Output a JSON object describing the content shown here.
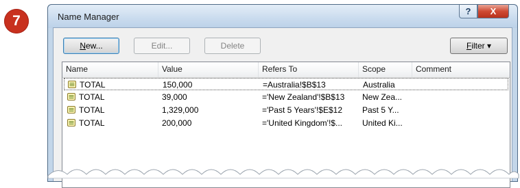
{
  "step": {
    "number": "7"
  },
  "window": {
    "title": "Name Manager",
    "help_label": "?",
    "close_label": "X"
  },
  "toolbar": {
    "new_label_u": "N",
    "new_label_rest": "ew...",
    "edit_label": "Edit...",
    "delete_label": "Delete",
    "filter_label_u": "F",
    "filter_label_rest": "ilter ▾"
  },
  "list": {
    "columns": [
      "Name",
      "Value",
      "Refers To",
      "Scope",
      "Comment"
    ],
    "rows": [
      {
        "name": "TOTAL",
        "value": "150,000",
        "refers_to": "=Australia!$B$13",
        "scope": "Australia",
        "comment": ""
      },
      {
        "name": "TOTAL",
        "value": "39,000",
        "refers_to": "='New Zealand'!$B$13",
        "scope": "New Zea...",
        "comment": ""
      },
      {
        "name": "TOTAL",
        "value": "1,329,000",
        "refers_to": "='Past 5 Years'!$E$12",
        "scope": "Past 5 Y...",
        "comment": ""
      },
      {
        "name": "TOTAL",
        "value": "200,000",
        "refers_to": "='United Kingdom'!$...",
        "scope": "United Ki...",
        "comment": ""
      }
    ],
    "selected_row": 0
  },
  "colors": {
    "badge": "#c8301e",
    "close_button": "#cf4a33",
    "window_frame": "#c3d6e9"
  },
  "icons": {
    "row_icon": "named-range-icon"
  }
}
